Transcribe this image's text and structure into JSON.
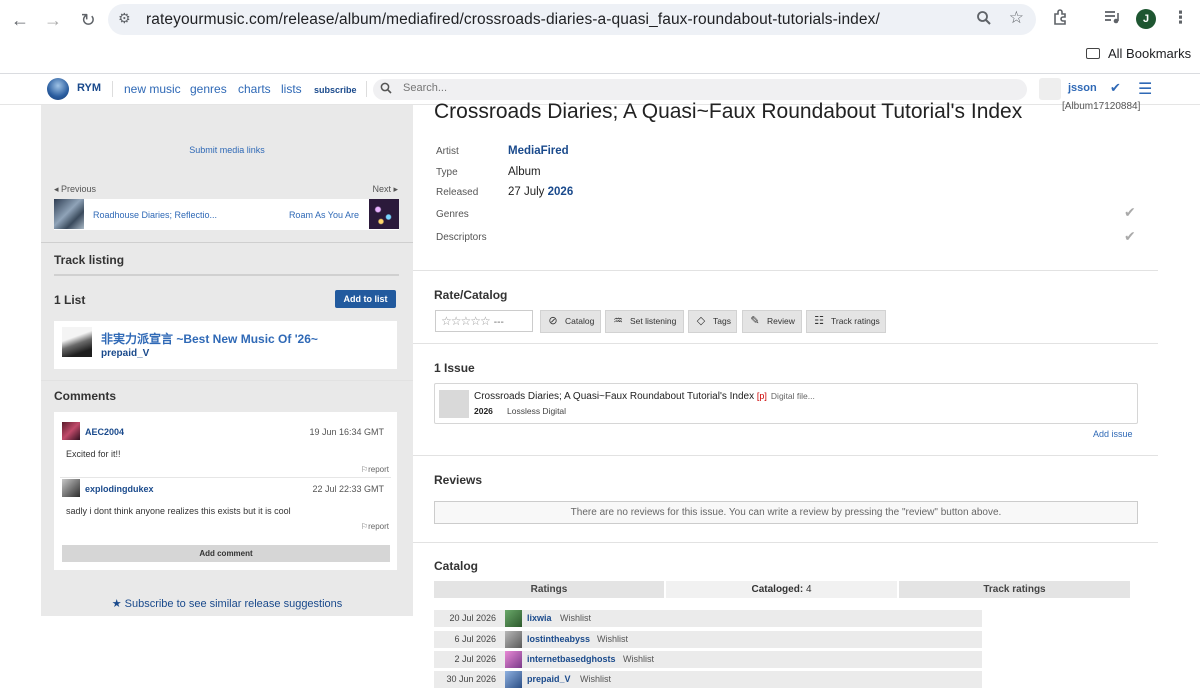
{
  "browser": {
    "url": "rateyourmusic.com/release/album/mediafired/crossroads-diaries-a-quasi_faux-roundabout-tutorials-index/",
    "bookmarks_label": "All Bookmarks",
    "profile_initial": "J"
  },
  "header": {
    "logo": "RYM",
    "nav": [
      "new music",
      "genres",
      "charts",
      "lists",
      "subscribe"
    ],
    "search_placeholder": "Search...",
    "username": "jsson"
  },
  "left": {
    "submit_media": "Submit media links",
    "previous_label": "◂ Previous",
    "next_label": "Next ▸",
    "previous_title": "Roadhouse Diaries; Reflectio...",
    "next_title": "Roam As You Are",
    "track_listing": "Track listing",
    "lists_heading": "1 List",
    "add_to_list": "Add to list",
    "list_title": "非実力派宣言 ~Best New Music Of '26~",
    "list_user": "prepaid_V",
    "comments_heading": "Comments",
    "comments": [
      {
        "user": "AEC2004",
        "date": "19 Jun 16:34 GMT",
        "text": "Excited for it!!",
        "report": "report"
      },
      {
        "user": "explodingdukex",
        "date": "22 Jul 22:33 GMT",
        "text": "sadly i dont think anyone realizes this exists but it is cool",
        "report": "report"
      }
    ],
    "add_comment": "Add comment",
    "subscribe_similar": "Subscribe to see similar release suggestions"
  },
  "album": {
    "title": "Crossroads Diaries; A Quasi~Faux Roundabout Tutorial's Index",
    "id": "[Album17120884]",
    "artist_label": "Artist",
    "artist": "MediaFired",
    "type_label": "Type",
    "type": "Album",
    "released_label": "Released",
    "released_day": "27 July",
    "released_year": "2026",
    "genres_label": "Genres",
    "descriptors_label": "Descriptors"
  },
  "rate": {
    "heading": "Rate/Catalog",
    "stars": "☆☆☆☆☆",
    "rating_placeholder": "---",
    "buttons": [
      "Catalog",
      "Set listening",
      "Tags",
      "Review",
      "Track ratings"
    ]
  },
  "issues": {
    "heading": "1 Issue",
    "title": "Crossroads Diaries; A Quasi~Faux Roundabout Tutorial's Index",
    "p_tag": "[p]",
    "format_short": "Digital file...",
    "year": "2026",
    "format": "Lossless Digital",
    "add_issue": "Add issue"
  },
  "reviews": {
    "heading": "Reviews",
    "empty_text": "There are no reviews for this issue. You can write a review by pressing the \"review\" button above."
  },
  "catalog": {
    "heading": "Catalog",
    "tab_ratings": "Ratings",
    "tab_cataloged_label": "Cataloged:",
    "tab_cataloged_count": "4",
    "tab_track_ratings": "Track ratings",
    "rows": [
      {
        "date": "20 Jul 2026",
        "user": "lixwia",
        "status": "Wishlist"
      },
      {
        "date": "6 Jul 2026",
        "user": "lostintheabyss",
        "status": "Wishlist"
      },
      {
        "date": "2 Jul 2026",
        "user": "internetbasedghosts",
        "status": "Wishlist"
      },
      {
        "date": "30 Jun 2026",
        "user": "prepaid_V",
        "status": "Wishlist"
      }
    ]
  }
}
